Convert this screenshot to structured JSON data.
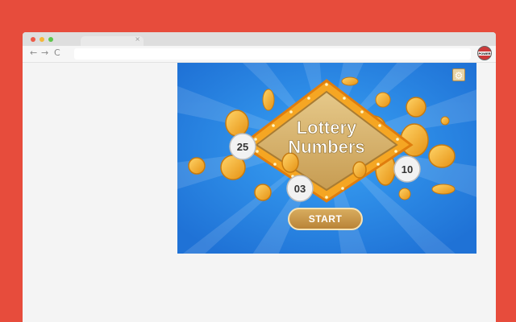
{
  "browser": {
    "tab_close": "×",
    "nav": {
      "back": "←",
      "forward": "→",
      "reload": "C"
    },
    "extension_label": "POWER"
  },
  "game": {
    "title_line1": "Lottery",
    "title_line2": "Numbers",
    "balls": [
      "25",
      "10",
      "03"
    ],
    "start_label": "START",
    "settings_icon": "gear-icon",
    "colors": {
      "background": "#2c8ae8",
      "marquee": "#f5a623",
      "board": "#d9b66f",
      "coin": "#f5b52e",
      "button": "#c9974a"
    }
  }
}
